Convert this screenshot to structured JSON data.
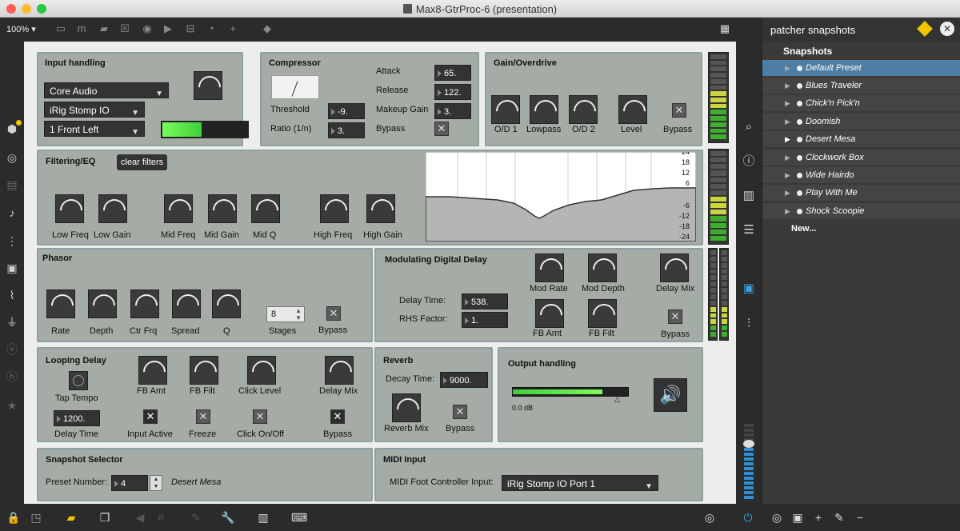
{
  "window": {
    "title": "Max8-GtrProc-6 (presentation)",
    "zoom": "100%"
  },
  "colors": {
    "accent_green": "#7cfc5c",
    "select_blue": "#4e7ea3",
    "panel_bg": "#a4aca5",
    "panel_border": "#8fa0a2"
  },
  "toolbar_icons": [
    "lock-icon",
    "comment-icon",
    "message-icon",
    "toggle-icon",
    "button-icon",
    "inlet-icon",
    "slider-icon",
    "dial-icon",
    "add-icon",
    "paint-icon",
    "grid-icon"
  ],
  "left_icons": [
    "package-icon",
    "record-icon",
    "device-icon",
    "music-icon",
    "sequence-icon",
    "image-icon",
    "clip-icon",
    "plug-icon",
    "v-icon",
    "h-icon",
    "star-icon"
  ],
  "right_icons": [
    "search-icon",
    "info-icon",
    "book-icon",
    "list-icon",
    "camera-icon",
    "mixer-icon"
  ],
  "input_handling": {
    "title": "Input handling",
    "driver": "Core Audio",
    "device": "iRig Stomp IO",
    "channel": "1 Front Left",
    "level": 0.72
  },
  "compressor": {
    "title": "Compressor",
    "threshold_label": "Threshold",
    "threshold": "-9.",
    "ratio_label": "Ratio (1/n)",
    "ratio": "3.",
    "attack_label": "Attack",
    "attack": "65.",
    "release_label": "Release",
    "release": "122.",
    "makeup_label": "Makeup Gain",
    "makeup": "3.",
    "bypass_label": "Bypass"
  },
  "gain": {
    "title": "Gain/Overdrive",
    "labels": [
      "O/D 1",
      "Lowpass",
      "O/D 2",
      "Level"
    ],
    "bypass_label": "Bypass"
  },
  "filtering": {
    "title": "Filtering/EQ",
    "clear_label": "clear filters",
    "labels": [
      "Low Freq",
      "Low Gain",
      "Mid Freq",
      "Mid Gain",
      "Mid Q",
      "High Freq",
      "High Gain"
    ],
    "scale": [
      "24",
      "18",
      "12",
      "6",
      "-6",
      "-12",
      "-18",
      "-24"
    ]
  },
  "phasor": {
    "title": "Phasor",
    "labels": [
      "Rate",
      "Depth",
      "Ctr Frq",
      "Spread",
      "Q"
    ],
    "stages": "8",
    "stages_label": "Stages",
    "bypass_label": "Bypass"
  },
  "mod_delay": {
    "title": "Modulating Digital Delay",
    "delay_time_label": "Delay Time:",
    "delay_time": "538.",
    "rhs_label": "RHS Factor:",
    "rhs": "1.",
    "labels": [
      "Mod Rate",
      "Mod Depth",
      "Delay Mix",
      "FB Amt",
      "FB Filt"
    ],
    "bypass_label": "Bypass"
  },
  "looping": {
    "title": "Looping Delay",
    "tap_label": "Tap Tempo",
    "delay_time": "1200.",
    "delay_time_label": "Delay Time",
    "labels": [
      "FB Amt",
      "FB Filt",
      "Click Level",
      "Delay Mix"
    ],
    "toggles": [
      "Input Active",
      "Freeze",
      "Click On/Off",
      "Bypass"
    ]
  },
  "reverb": {
    "title": "Reverb",
    "decay_label": "Decay Time:",
    "decay": "9000.",
    "mix_label": "Reverb Mix",
    "bypass_label": "Bypass"
  },
  "output": {
    "title": "Output handling",
    "db": "0.0 dB",
    "level": 0.78
  },
  "snapshot_selector": {
    "title": "Snapshot Selector",
    "label": "Preset Number:",
    "number": "4",
    "name": "Desert Mesa"
  },
  "midi": {
    "title": "MIDI Input",
    "label": "MIDI Foot Controller Input:",
    "port": "iRig Stomp IO Port 1"
  },
  "sidepanel": {
    "title": "patcher snapshots",
    "list_title": "Snapshots",
    "items": [
      "Default Preset",
      "Blues Traveler",
      "Chick'n Pick'n",
      "Doomish",
      "Desert Mesa",
      "Clockwork Box",
      "Wide Hairdo",
      "Play With Me",
      "Shock Scoopie"
    ],
    "new_label": "New..."
  }
}
